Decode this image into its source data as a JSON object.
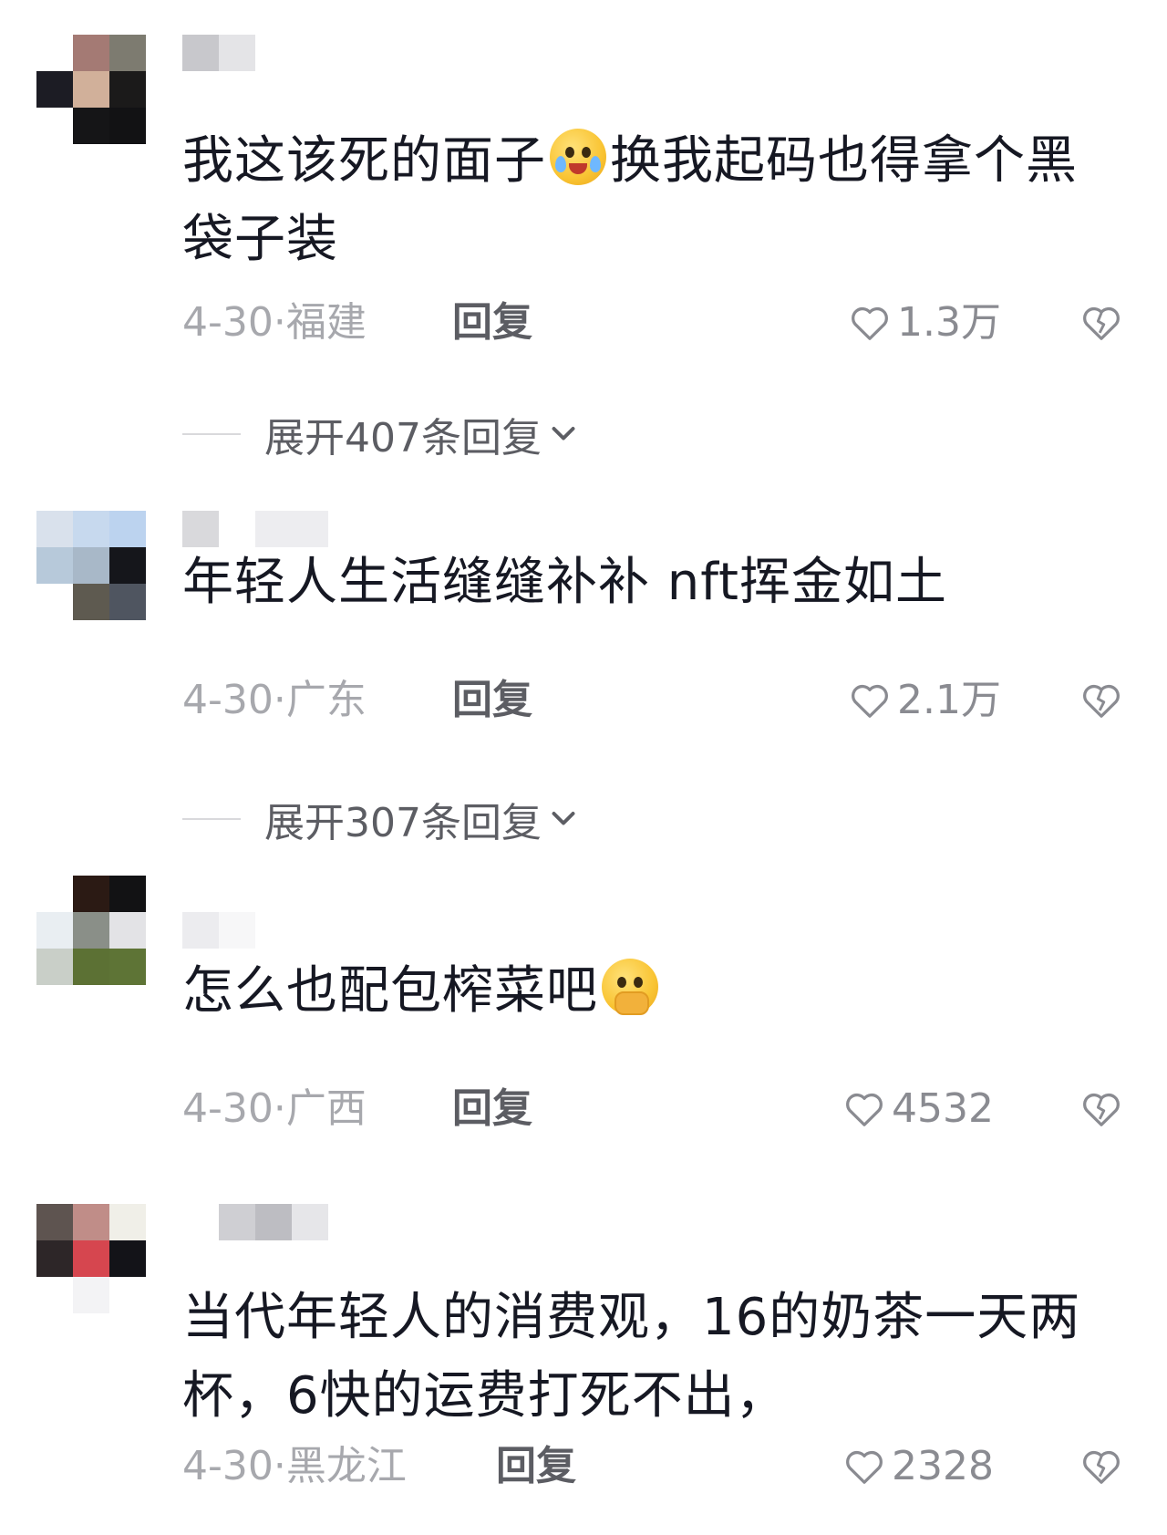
{
  "comments": [
    {
      "text_before": "我这该死的面子",
      "emoji": "crying-laughing-face-icon",
      "text_after": "换我起码也得拿个黑袋子装",
      "time_location": "4-30·福建",
      "reply_label": "回复",
      "likes": "1.3万",
      "expand_label": "展开407条回复"
    },
    {
      "text_before": "年轻人生活缝缝补补 nft挥金如土",
      "time_location": "4-30·广东",
      "reply_label": "回复",
      "likes": "2.1万",
      "expand_label": "展开307条回复"
    },
    {
      "text_before": "怎么也配包榨菜吧",
      "emoji": "shy-covering-mouth-face-icon",
      "time_location": "4-30·广西",
      "reply_label": "回复",
      "likes": "4532"
    },
    {
      "text_before": "当代年轻人的消费观，16的奶茶一天两杯，6快的运费打死不出，",
      "time_location": "4-30·黑龙江",
      "reply_label": "回复",
      "likes": "2328"
    }
  ],
  "colors": {
    "text": "#161823",
    "meta": "#a7a8ad",
    "reply": "#5c5d63",
    "divider": "#d9d9dc"
  },
  "icons": {
    "like": "heart-outline-icon",
    "dislike": "broken-heart-outline-icon",
    "expand": "chevron-down-icon"
  }
}
